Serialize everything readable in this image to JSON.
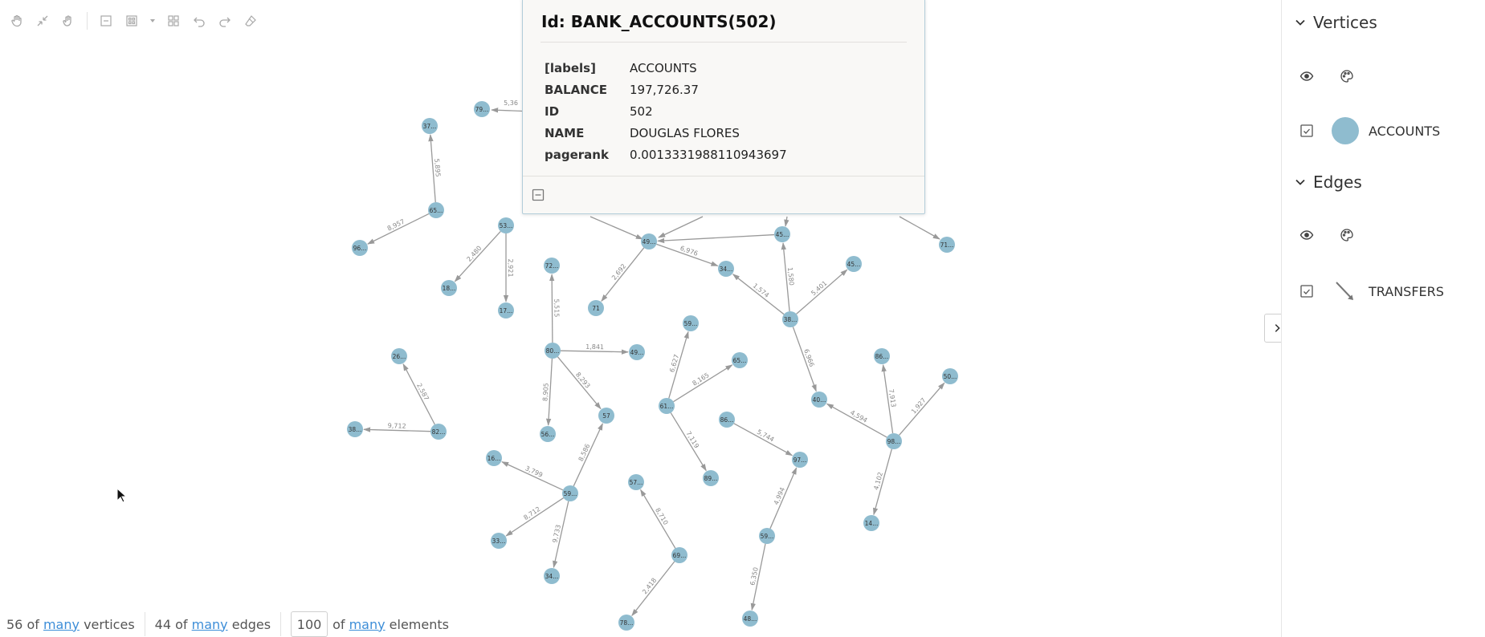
{
  "toolbar": {
    "buttons": [
      "pan-icon",
      "fit-icon",
      "select-icon",
      "collapse-icon",
      "layout-icon",
      "layout-dropdown-icon",
      "group-icon",
      "undo-icon",
      "redo-icon",
      "eraser-icon"
    ]
  },
  "popup": {
    "title": "Id: BANK_ACCOUNTS(502)",
    "properties": [
      {
        "key": "[labels]",
        "value": "ACCOUNTS"
      },
      {
        "key": "BALANCE",
        "value": "197,726.37"
      },
      {
        "key": "ID",
        "value": "502"
      },
      {
        "key": "NAME",
        "value": "DOUGLAS FLORES"
      },
      {
        "key": "pagerank",
        "value": "0.0013331988110943697"
      }
    ]
  },
  "sidebar": {
    "vertices_title": "Vertices",
    "vertex_label": "ACCOUNTS",
    "edges_title": "Edges",
    "edge_label": "TRANSFERS"
  },
  "footer": {
    "vertices_count": "56",
    "vertices_of": "of",
    "vertices_link": "many",
    "vertices_suffix": "vertices",
    "edges_count": "44",
    "edges_of": "of",
    "edges_link": "many",
    "edges_suffix": "edges",
    "limit_value": "100",
    "elements_of": "of",
    "elements_link": "many",
    "elements_suffix": "elements"
  },
  "colors": {
    "node": "#8fbccf",
    "edge": "#999999",
    "link": "#3d8ed8"
  },
  "graph": {
    "nodes": [
      {
        "id": "n79",
        "label": "79..."
      },
      {
        "id": "n37",
        "label": "37..."
      },
      {
        "id": "n65a",
        "label": "65..."
      },
      {
        "id": "n96",
        "label": "96..."
      },
      {
        "id": "n53",
        "label": "53..."
      },
      {
        "id": "n18",
        "label": "18..."
      },
      {
        "id": "n17",
        "label": "17..."
      },
      {
        "id": "n72",
        "label": "72..."
      },
      {
        "id": "n49a",
        "label": "49..."
      },
      {
        "id": "n34a",
        "label": "34..."
      },
      {
        "id": "n71",
        "label": "71"
      },
      {
        "id": "n45a",
        "label": "45..."
      },
      {
        "id": "n45b",
        "label": "45..."
      },
      {
        "id": "n71b",
        "label": "71..."
      },
      {
        "id": "n38a",
        "label": "38..."
      },
      {
        "id": "n80",
        "label": "80..."
      },
      {
        "id": "n49b",
        "label": "49..."
      },
      {
        "id": "n56",
        "label": "56..."
      },
      {
        "id": "n57",
        "label": "57"
      },
      {
        "id": "n59a",
        "label": "59..."
      },
      {
        "id": "n65b",
        "label": "65..."
      },
      {
        "id": "n61",
        "label": "61..."
      },
      {
        "id": "n89",
        "label": "89..."
      },
      {
        "id": "n86a",
        "label": "86..."
      },
      {
        "id": "n97",
        "label": "97..."
      },
      {
        "id": "n40",
        "label": "40..."
      },
      {
        "id": "n86b",
        "label": "86..."
      },
      {
        "id": "n98",
        "label": "98..."
      },
      {
        "id": "n50",
        "label": "50..."
      },
      {
        "id": "n14",
        "label": "14..."
      },
      {
        "id": "n26",
        "label": "26..."
      },
      {
        "id": "n82",
        "label": "82..."
      },
      {
        "id": "n38b",
        "label": "38..."
      },
      {
        "id": "n16",
        "label": "16..."
      },
      {
        "id": "n59b",
        "label": "59..."
      },
      {
        "id": "n33",
        "label": "33..."
      },
      {
        "id": "n34b",
        "label": "34..."
      },
      {
        "id": "n57b",
        "label": "57..."
      },
      {
        "id": "n69",
        "label": "69..."
      },
      {
        "id": "n78",
        "label": "78..."
      },
      {
        "id": "n59c",
        "label": "59..."
      },
      {
        "id": "n48",
        "label": "48..."
      }
    ],
    "edges": [
      {
        "from": "n65a",
        "to": "n37",
        "label": "5,895"
      },
      {
        "from": "n65a",
        "to": "n96",
        "label": "8,957"
      },
      {
        "from": "n53",
        "to": "n18",
        "label": "2,480"
      },
      {
        "from": "n53",
        "to": "n17",
        "label": "2,921"
      },
      {
        "from": "n49a",
        "to": "n34a",
        "label": "6,976"
      },
      {
        "from": "n49a",
        "to": "n71",
        "label": "2,692"
      },
      {
        "from": "n38a",
        "to": "n45a",
        "label": "1,580"
      },
      {
        "from": "n38a",
        "to": "n34a",
        "label": "1,574"
      },
      {
        "from": "n38a",
        "to": "n45b",
        "label": "5,401"
      },
      {
        "from": "n38a",
        "to": "n40",
        "label": "6,966"
      },
      {
        "from": "n80",
        "to": "n72",
        "label": "5,515"
      },
      {
        "from": "n80",
        "to": "n49b",
        "label": "1,841"
      },
      {
        "from": "n80",
        "to": "n56",
        "label": "8,905"
      },
      {
        "from": "n80",
        "to": "n57",
        "label": "8,293"
      },
      {
        "from": "n61",
        "to": "n59a",
        "label": "6,627"
      },
      {
        "from": "n61",
        "to": "n65b",
        "label": "8,165"
      },
      {
        "from": "n61",
        "to": "n89",
        "label": "7,119"
      },
      {
        "from": "n86a",
        "to": "n97",
        "label": "5,744"
      },
      {
        "from": "n98",
        "to": "n40",
        "label": "4,594"
      },
      {
        "from": "n98",
        "to": "n86b",
        "label": "7,913"
      },
      {
        "from": "n98",
        "to": "n50",
        "label": "1,927"
      },
      {
        "from": "n98",
        "to": "n14",
        "label": "4,102"
      },
      {
        "from": "n82",
        "to": "n26",
        "label": "2,587"
      },
      {
        "from": "n82",
        "to": "n38b",
        "label": "9,712"
      },
      {
        "from": "n59b",
        "to": "n16",
        "label": "3,799"
      },
      {
        "from": "n59b",
        "to": "n33",
        "label": "8,712"
      },
      {
        "from": "n59b",
        "to": "n34b",
        "label": "9,733"
      },
      {
        "from": "n59b",
        "to": "n57",
        "label": "8,586"
      },
      {
        "from": "n69",
        "to": "n57b",
        "label": "8,710"
      },
      {
        "from": "n69",
        "to": "n78",
        "label": "2,418"
      },
      {
        "from": "n59c",
        "to": "n97",
        "label": "4,994"
      },
      {
        "from": "n59c",
        "to": "n48",
        "label": "6,350"
      },
      {
        "from": "n45a",
        "to": "n49a",
        "label": ""
      },
      {
        "from": "n71b",
        "to": "n71b",
        "label": ""
      },
      {
        "from": "n79",
        "to": "n79",
        "label": "5,36"
      }
    ]
  }
}
